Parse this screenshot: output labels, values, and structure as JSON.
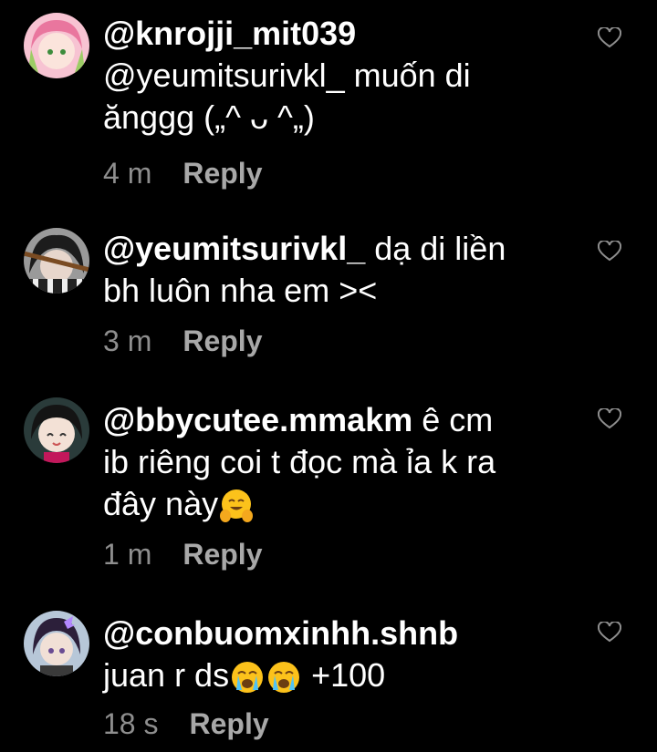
{
  "comments": [
    {
      "username": "@knrojji_mit039",
      "body_lines": [
        "@yeumitsurivkl_ muốn di",
        "ănggg („^ ᴗ ^„)"
      ],
      "time": "4 m",
      "reply_label": "Reply",
      "avatar_icon": "pink-hair-anime-avatar"
    },
    {
      "username": "@yeumitsurivkl_",
      "body_lines": [
        " dạ di liền",
        "bh luôn nha em ><"
      ],
      "time": "3 m",
      "reply_label": "Reply",
      "avatar_icon": "dark-hair-anime-avatar"
    },
    {
      "username": "@bbycutee.mmakm",
      "body_lines": [
        " ê cm",
        "ib riêng coi t đọc mà ỉa k ra",
        "đây này"
      ],
      "time": "1 m",
      "reply_label": "Reply",
      "avatar_icon": "smiling-anime-avatar",
      "emoji": "hugging-face"
    },
    {
      "username": "@conbuomxinhh.shnb",
      "body_lines": [
        "juan r ds",
        " +100"
      ],
      "time": "18 s",
      "reply_label": "Reply",
      "avatar_icon": "butterfly-anime-avatar",
      "emoji": "crying-face"
    }
  ],
  "colors": {
    "background": "#000000",
    "text": "#ffffff",
    "meta": "#8e8e8e"
  }
}
